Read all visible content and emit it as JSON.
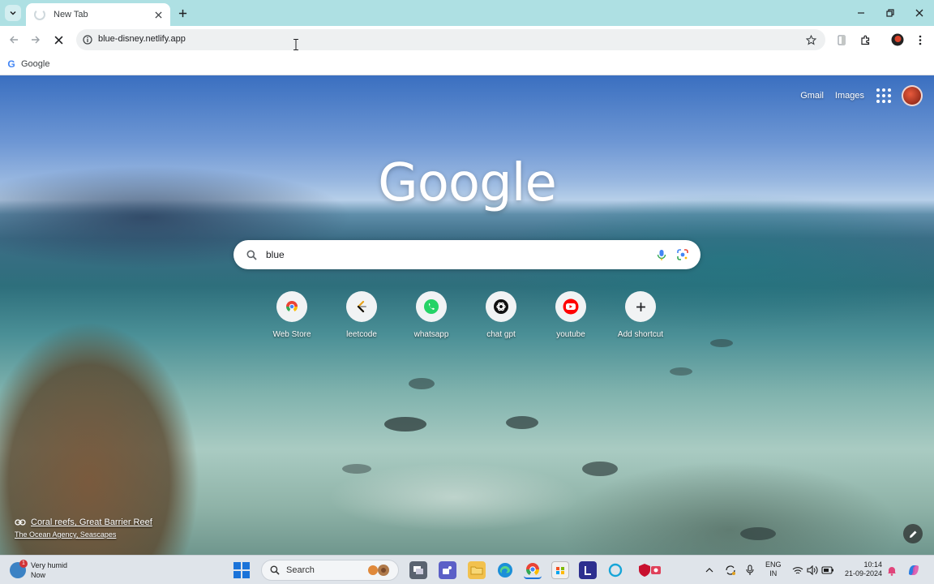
{
  "browser": {
    "tab": {
      "title": "New Tab"
    },
    "omnibox": {
      "url": "blue-disney.netlify.app"
    },
    "bookmarks": [
      {
        "label": "Google"
      }
    ]
  },
  "ntp": {
    "top_links": {
      "gmail": "Gmail",
      "images": "Images"
    },
    "logo": "Google",
    "search": {
      "value": "blue"
    },
    "shortcuts": [
      {
        "label": "Web Store",
        "icon": "chrome-web-store-icon"
      },
      {
        "label": "leetcode",
        "icon": "leetcode-icon"
      },
      {
        "label": "whatsapp",
        "icon": "whatsapp-icon"
      },
      {
        "label": "chat gpt",
        "icon": "chatgpt-icon"
      },
      {
        "label": "youtube",
        "icon": "youtube-icon"
      },
      {
        "label": "Add shortcut",
        "icon": "plus-icon"
      }
    ],
    "attribution": {
      "title": "Coral reefs, Great Barrier Reef",
      "subtitle": "The Ocean Agency, Seascapes"
    }
  },
  "taskbar": {
    "weather": {
      "line1": "Very humid",
      "line2": "Now",
      "badge": "1"
    },
    "search_label": "Search",
    "language": {
      "line1": "ENG",
      "line2": "IN"
    },
    "clock": {
      "time": "10:14",
      "date": "21-09-2024"
    }
  },
  "colors": {
    "tabstrip": "#aee0e3",
    "accent_blue": "#1a73e8",
    "whatsapp_green": "#25d366",
    "youtube_red": "#ff0000"
  }
}
